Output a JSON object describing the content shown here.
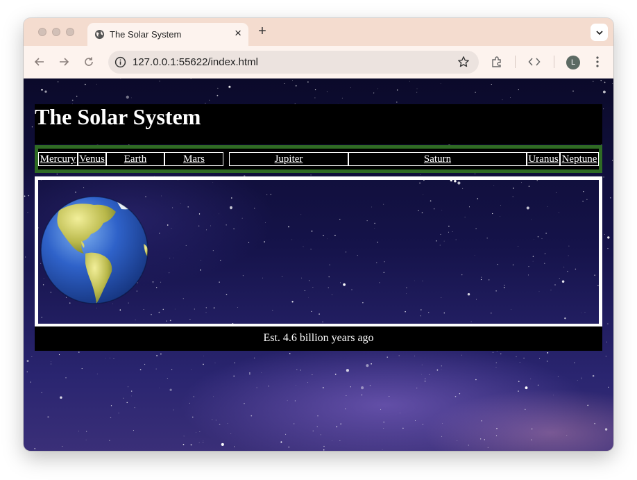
{
  "browser": {
    "tab_title": "The Solar System",
    "url": "127.0.0.1:55622/index.html",
    "profile_initial": "L",
    "icons": [
      "globe-icon",
      "close-icon",
      "plus-icon",
      "chevron-down-icon",
      "back-arrow-icon",
      "forward-arrow-icon",
      "reload-icon",
      "site-info-icon",
      "bookmark-star-icon",
      "extensions-icon",
      "code-icon",
      "more-vert-icon"
    ]
  },
  "page": {
    "title": "The Solar System",
    "nav": [
      "Mercury",
      "Venus",
      "Earth",
      "Mars",
      "Jupiter",
      "Saturn",
      "Uranus",
      "Neptune"
    ],
    "footer": "Est. 4.6 billion years ago",
    "colors": {
      "nav_border": "#2f6b24",
      "boxes": "#000000",
      "text": "#ffffff"
    }
  }
}
